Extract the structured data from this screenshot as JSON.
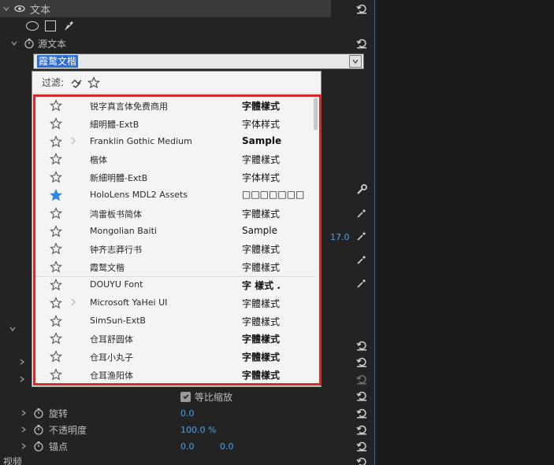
{
  "top": {
    "layer_name": "文本",
    "source_text_label": "源文本"
  },
  "font_select": {
    "value": "霞鹜文楷"
  },
  "filter": {
    "label": "过滤:"
  },
  "fonts": [
    {
      "name": "锐字真言体免费商用",
      "sample": "字體樣式",
      "starred": false,
      "expandable": false,
      "bold": true
    },
    {
      "name": "細明體-ExtB",
      "sample": "字体样式",
      "starred": false,
      "expandable": false,
      "bold": false
    },
    {
      "name": "Franklin Gothic Medium",
      "sample": "Sample",
      "starred": false,
      "expandable": true,
      "bold": true
    },
    {
      "name": "楷体",
      "sample": "字體樣式",
      "starred": false,
      "expandable": false,
      "bold": false
    },
    {
      "name": "新細明體-ExtB",
      "sample": "字体样式",
      "starred": false,
      "expandable": false,
      "bold": false
    },
    {
      "name": "HoloLens MDL2 Assets",
      "sample": "□□□□□□□",
      "starred": true,
      "expandable": false,
      "bold": false
    },
    {
      "name": "鸿雷板书简体",
      "sample": "字體樣式",
      "starred": false,
      "expandable": false,
      "bold": false
    },
    {
      "name": "Mongolian Baiti",
      "sample": "Sample",
      "starred": false,
      "expandable": false,
      "bold": false
    },
    {
      "name": "钟齐志莽行书",
      "sample": "字體樣式",
      "starred": false,
      "expandable": false,
      "bold": false
    },
    {
      "name": "霞鹜文楷",
      "sample": "字體樣式",
      "starred": false,
      "expandable": false,
      "bold": false
    },
    {
      "name": "DOUYU Font",
      "sample": "字 樣式 .",
      "starred": false,
      "expandable": false,
      "bold": true
    },
    {
      "name": "Microsoft YaHei UI",
      "sample": "字體樣式",
      "starred": false,
      "expandable": true,
      "bold": false
    },
    {
      "name": "SimSun-ExtB",
      "sample": "字體樣式",
      "starred": false,
      "expandable": false,
      "bold": false
    },
    {
      "name": "仓耳舒圆体",
      "sample": "字體樣式",
      "starred": false,
      "expandable": false,
      "bold": true
    },
    {
      "name": "仓耳小丸子",
      "sample": "字體樣式",
      "starred": false,
      "expandable": false,
      "bold": true
    },
    {
      "name": "仓耳渔阳体",
      "sample": "字體樣式",
      "starred": false,
      "expandable": false,
      "bold": true
    }
  ],
  "right_values": {
    "value_17": "17.0"
  },
  "bottom": {
    "uniform_scale": "等比缩放",
    "rotation_label": "旋转",
    "rotation_value": "0.0",
    "opacity_label": "不透明度",
    "opacity_value": "100.0 %",
    "anchor_label": "锚点",
    "anchor_x": "0.0",
    "anchor_y": "0.0",
    "video_label": "视频"
  },
  "colors": {
    "accent_blue": "#4ba3f0",
    "highlight_border": "#d32a2a",
    "selection_blue": "#2b6fd6"
  }
}
